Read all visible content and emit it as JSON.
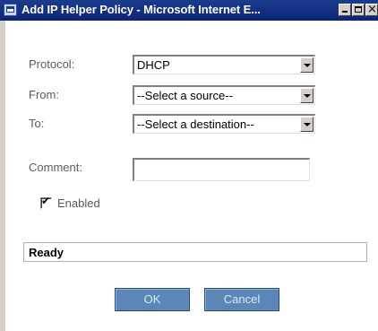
{
  "window": {
    "title": "Add IP Helper Policy - Microsoft Internet E..."
  },
  "form": {
    "protocol_label": "Protocol:",
    "protocol_value": "DHCP",
    "from_label": "From:",
    "from_value": "--Select a source--",
    "to_label": "To:",
    "to_value": "--Select a destination--",
    "comment_label": "Comment:",
    "comment_value": "",
    "enabled_label": "Enabled",
    "enabled_checked": true
  },
  "status": {
    "text": "Ready"
  },
  "buttons": {
    "ok_label": "OK",
    "cancel_label": "Cancel"
  },
  "colors": {
    "titlebar": "#0b247a",
    "button": "#5a87b8",
    "label_text": "#5c5c5c"
  },
  "icons": {
    "app": "ie-window-icon",
    "minimize": "minimize-icon",
    "maximize": "maximize-icon",
    "close": "close-icon",
    "dropdown": "chevron-down-icon",
    "check": "checkmark-icon"
  }
}
